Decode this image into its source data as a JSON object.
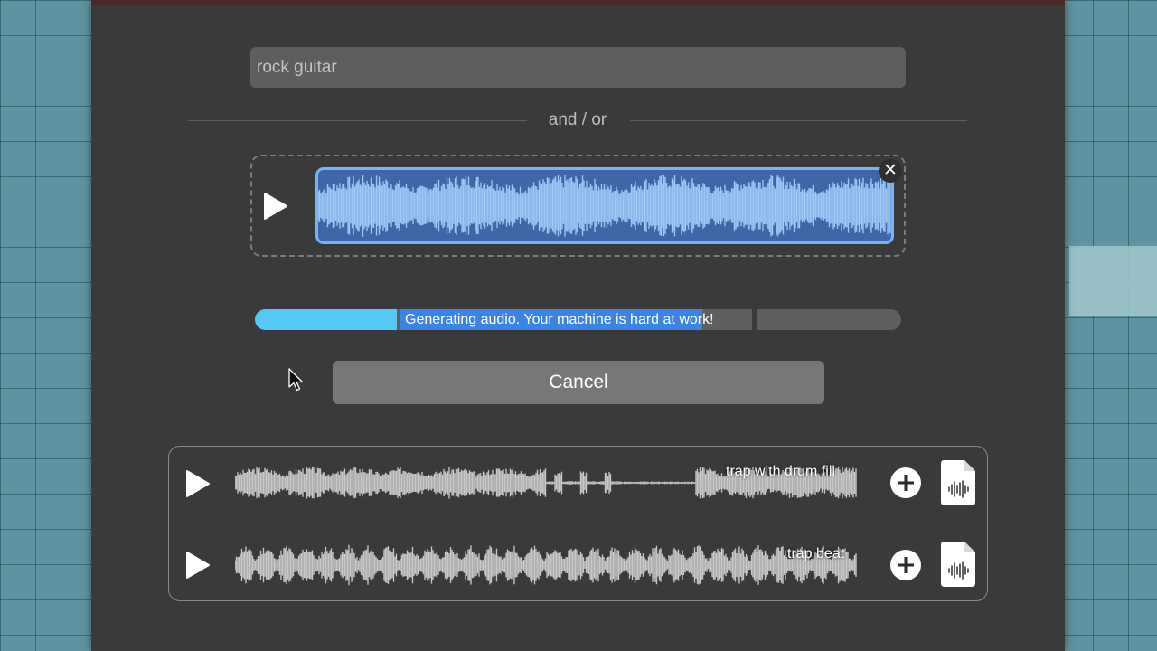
{
  "prompt": {
    "value": "rock guitar"
  },
  "separator": {
    "label": "and / or"
  },
  "progress": {
    "text": "Generating audio. Your machine is hard at work!",
    "fraction": 0.22
  },
  "cancel": {
    "label": "Cancel"
  },
  "results": [
    {
      "label": "trap with drum fill"
    },
    {
      "label": "trap beat"
    }
  ],
  "icons": [
    "play-icon",
    "close-icon",
    "plus-circle-icon",
    "audio-file-icon",
    "mouse-cursor-icon"
  ],
  "colors": {
    "dialog": "#3a3a3a",
    "accent": "#6fb6ff",
    "progress_fill": "#55c8f5",
    "selection": "#3a84e6"
  }
}
